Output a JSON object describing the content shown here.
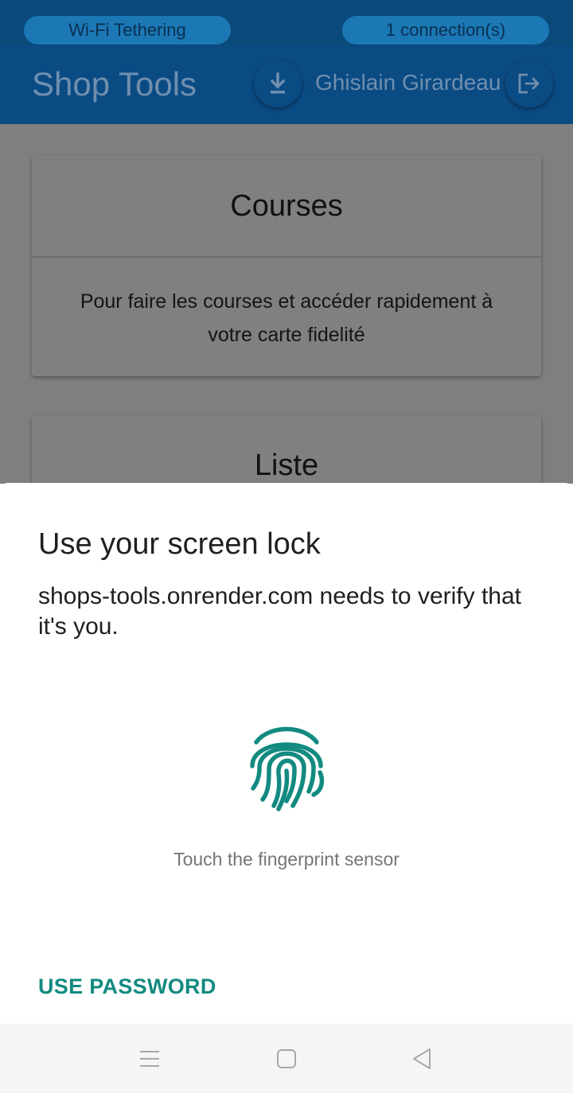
{
  "status_bar": {
    "wifi_label": "Wi-Fi Tethering",
    "connections_label": "1 connection(s)"
  },
  "app_bar": {
    "title": "Shop Tools",
    "user_name": "Ghislain Girardeau",
    "download_icon": "download-icon",
    "logout_icon": "logout-icon"
  },
  "cards": {
    "courses": {
      "title": "Courses",
      "description": "Pour faire les courses et accéder rapidement à votre carte fidelité"
    },
    "liste": {
      "title": "Liste"
    }
  },
  "dialog": {
    "title": "Use your screen lock",
    "subtitle": "shops-tools.onrender.com needs to verify that it's you.",
    "icon": "fingerprint-icon",
    "hint": "Touch the fingerprint sensor",
    "use_password_label": "USE PASSWORD",
    "accent_color": "#128a80"
  },
  "nav_bar": {
    "menu_icon": "menu-icon",
    "home_icon": "home-icon",
    "back_icon": "back-icon"
  },
  "colors": {
    "status_bar": "#0a4a7a",
    "app_bar": "#0b4b84",
    "scrim_background": "#7f7f7f"
  }
}
